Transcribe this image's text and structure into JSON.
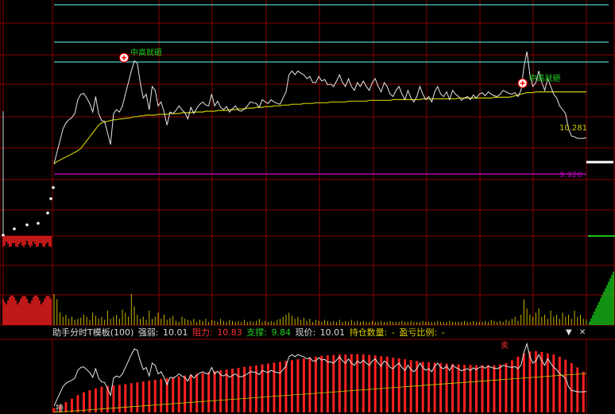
{
  "colors": {
    "background": "#000000",
    "grid": "#8b0000",
    "price_line": "#e6e6e6",
    "avg_line": "#c8c800",
    "cyan": "#4fc9c9",
    "purple": "#b400b4",
    "up": "#ff2020",
    "down": "#19c219",
    "vol_yellow": "#c8b400",
    "signal_green": "#1ed01e"
  },
  "indicator_bar": {
    "name": "助手分时T模板(100)",
    "strength_label": "强弱:",
    "strength_value": "10.01",
    "resistance_label": "阻力:",
    "resistance_value": "10.83",
    "support_label": "支撑:",
    "support_value": "9.84",
    "price_label": "现价:",
    "price_value": "10.01",
    "position_label": "持仓数量:",
    "position_value": "-",
    "pnl_label": "盈亏比例:",
    "pnl_value": "-",
    "menu_icon": "dropdown-arrow-icon",
    "close_icon": "close-icon"
  },
  "chart_data": {
    "type": "line",
    "price_axis_labels": [
      "10.281",
      "9.920"
    ],
    "signals": [
      {
        "text": "中高就砸",
        "at_index": 27
      },
      {
        "text": "中高就砸",
        "at_index": 161
      }
    ],
    "lower_signal": {
      "text": "卖"
    },
    "lower_label": {
      "text": "持"
    },
    "price": [
      10.05,
      10.2,
      10.35,
      10.5,
      10.58,
      10.62,
      10.65,
      10.7,
      10.88,
      10.95,
      10.96,
      10.9,
      10.83,
      10.72,
      10.92,
      10.7,
      10.61,
      10.6,
      10.45,
      10.3,
      10.7,
      10.75,
      10.72,
      10.8,
      10.95,
      11.1,
      11.25,
      11.38,
      11.35,
      11.1,
      10.9,
      10.95,
      10.75,
      11.05,
      11.0,
      10.8,
      10.85,
      10.72,
      10.55,
      10.72,
      10.7,
      10.74,
      10.8,
      10.75,
      10.71,
      10.63,
      10.78,
      10.7,
      10.77,
      10.82,
      10.85,
      10.81,
      10.8,
      10.95,
      10.8,
      10.86,
      10.78,
      10.75,
      10.79,
      10.72,
      10.76,
      10.8,
      10.74,
      10.73,
      10.76,
      10.8,
      10.85,
      10.84,
      10.83,
      10.78,
      10.88,
      10.85,
      10.83,
      10.88,
      10.85,
      10.83,
      10.82,
      10.9,
      10.98,
      11.2,
      11.25,
      11.2,
      11.25,
      11.22,
      11.2,
      11.15,
      11.18,
      11.1,
      11.1,
      11.18,
      11.12,
      11.14,
      11.07,
      11.08,
      11.05,
      11.12,
      11.2,
      11.1,
      11.05,
      11.15,
      11.05,
      11.0,
      11.1,
      11.05,
      11.12,
      11.05,
      11.0,
      11.1,
      11.15,
      11.05,
      10.98,
      11.1,
      11.05,
      10.95,
      10.92,
      11.0,
      11.05,
      10.95,
      10.88,
      11.0,
      10.9,
      10.85,
      10.92,
      11.05,
      10.95,
      10.88,
      10.92,
      10.85,
      10.98,
      11.05,
      10.95,
      10.92,
      10.98,
      10.88,
      11.0,
      10.95,
      10.92,
      10.87,
      10.9,
      10.92,
      10.88,
      10.94,
      10.9,
      10.95,
      10.97,
      10.93,
      10.98,
      10.95,
      10.93,
      10.92,
      10.95,
      11.0,
      10.98,
      10.96,
      10.95,
      10.97,
      10.92,
      11.0,
      11.3,
      11.5,
      11.2,
      11.05,
      11.1,
      11.25,
      11.1,
      11.0,
      11.15,
      11.05,
      10.95,
      10.9,
      10.8,
      10.75,
      10.7,
      10.5,
      10.41,
      10.4,
      10.38,
      10.38,
      10.38,
      10.39
    ],
    "avg": [
      10.05,
      10.08,
      10.1,
      10.12,
      10.14,
      10.16,
      10.18,
      10.2,
      10.22,
      10.25,
      10.3,
      10.35,
      10.4,
      10.45,
      10.5,
      10.55,
      10.58,
      10.59,
      10.6,
      10.61,
      10.62,
      10.62,
      10.63,
      10.63,
      10.64,
      10.64,
      10.65,
      10.66,
      10.66,
      10.67,
      10.67,
      10.68,
      10.68,
      10.68,
      10.68,
      10.69,
      10.69,
      10.69,
      10.69,
      10.7,
      10.7,
      10.7,
      10.7,
      10.71,
      10.71,
      10.71,
      10.71,
      10.72,
      10.72,
      10.72,
      10.72,
      10.73,
      10.73,
      10.73,
      10.73,
      10.74,
      10.74,
      10.74,
      10.74,
      10.75,
      10.75,
      10.75,
      10.76,
      10.76,
      10.76,
      10.77,
      10.77,
      10.77,
      10.78,
      10.78,
      10.78,
      10.79,
      10.79,
      10.79,
      10.8,
      10.8,
      10.8,
      10.81,
      10.81,
      10.81,
      10.82,
      10.82,
      10.82,
      10.82,
      10.83,
      10.83,
      10.83,
      10.83,
      10.84,
      10.84,
      10.84,
      10.84,
      10.84,
      10.85,
      10.85,
      10.85,
      10.85,
      10.85,
      10.85,
      10.86,
      10.86,
      10.86,
      10.86,
      10.86,
      10.86,
      10.86,
      10.87,
      10.87,
      10.87,
      10.87,
      10.87,
      10.87,
      10.87,
      10.87,
      10.88,
      10.88,
      10.88,
      10.88,
      10.88,
      10.88,
      10.88,
      10.88,
      10.88,
      10.88,
      10.89,
      10.89,
      10.89,
      10.89,
      10.89,
      10.89,
      10.89,
      10.89,
      10.89,
      10.89,
      10.89,
      10.89,
      10.9,
      10.9,
      10.9,
      10.9,
      10.9,
      10.9,
      10.9,
      10.9,
      10.9,
      10.9,
      10.9,
      10.9,
      10.91,
      10.91,
      10.91,
      10.91,
      10.91,
      10.91,
      10.92,
      10.93,
      10.94,
      10.95,
      10.96,
      10.97,
      10.97,
      10.97,
      10.98,
      10.98,
      10.98,
      10.98,
      10.98,
      10.98,
      10.98,
      10.98,
      10.98,
      10.98,
      10.98,
      10.98,
      10.98,
      10.98,
      10.98,
      10.98,
      10.98,
      10.98
    ],
    "volume": [
      30,
      25,
      12,
      8,
      10,
      6,
      8,
      5,
      6,
      7,
      10,
      8,
      5,
      12,
      9,
      6,
      8,
      5,
      14,
      6,
      8,
      10,
      6,
      15,
      12,
      8,
      30,
      18,
      10,
      6,
      8,
      5,
      14,
      6,
      8,
      12,
      6,
      10,
      5,
      7,
      9,
      4,
      3,
      8,
      6,
      5,
      4,
      6,
      3,
      5,
      4,
      6,
      3,
      5,
      4,
      3,
      6,
      4,
      3,
      5,
      4,
      3,
      4,
      3,
      5,
      3,
      4,
      3,
      4,
      6,
      3,
      4,
      3,
      4,
      3,
      5,
      6,
      8,
      10,
      12,
      9,
      6,
      8,
      5,
      7,
      4,
      6,
      3,
      5,
      4,
      3,
      5,
      4,
      3,
      4,
      3,
      5,
      3,
      4,
      3,
      5,
      3,
      4,
      3,
      4,
      3,
      3,
      4,
      3,
      3,
      4,
      3,
      3,
      4,
      3,
      3,
      3,
      4,
      3,
      3,
      4,
      3,
      3,
      3,
      4,
      3,
      3,
      3,
      3,
      4,
      3,
      3,
      3,
      4,
      3,
      3,
      3,
      3,
      4,
      3,
      3,
      4,
      3,
      3,
      3,
      4,
      3,
      5,
      4,
      3,
      4,
      3,
      5,
      4,
      6,
      8,
      4,
      10,
      25,
      16,
      10,
      8,
      12,
      16,
      8,
      10,
      6,
      14,
      8,
      10,
      6,
      12,
      8,
      10,
      6,
      14,
      8,
      10,
      6,
      5
    ],
    "lower_curve": [
      10.0,
      10.02,
      10.06,
      10.1,
      10.14,
      10.18,
      10.22,
      10.26,
      10.3,
      10.34,
      10.37,
      10.4,
      10.42,
      10.44,
      10.46,
      10.48,
      10.5,
      10.51,
      10.52,
      10.52,
      10.53,
      10.54,
      10.54,
      10.55,
      10.56,
      10.57,
      10.58,
      10.59,
      10.6,
      10.61,
      10.62,
      10.63,
      10.64,
      10.65,
      10.66,
      10.67,
      10.68,
      10.69,
      10.7,
      10.71,
      10.72,
      10.73,
      10.74,
      10.75,
      10.76,
      10.77,
      10.78,
      10.79,
      10.8,
      10.81,
      10.82,
      10.83,
      10.84,
      10.85,
      10.86,
      10.87,
      10.88,
      10.89,
      10.9,
      10.91,
      10.92,
      10.93,
      10.94,
      10.95,
      10.96,
      10.97,
      10.98,
      10.99,
      11.0,
      11.01,
      11.02,
      11.03,
      11.04,
      11.05,
      11.06,
      11.07,
      11.08,
      11.09,
      11.1,
      11.11,
      11.12,
      11.13,
      11.14,
      11.15,
      11.16,
      11.17,
      11.18,
      11.19,
      11.2,
      11.21,
      11.22,
      11.22,
      11.23,
      11.23,
      11.24,
      11.24,
      11.25,
      11.25,
      11.25,
      11.26,
      11.26,
      11.26,
      11.26,
      11.26,
      11.25,
      11.25,
      11.24,
      11.24,
      11.23,
      11.22,
      11.21,
      11.2,
      11.2,
      11.19,
      11.18,
      11.17,
      11.16,
      11.15,
      11.14,
      11.13,
      11.12,
      11.11,
      11.1,
      11.09,
      11.08,
      11.08,
      11.07,
      11.06,
      11.06,
      11.05,
      11.05,
      11.04,
      11.04,
      11.03,
      11.03,
      11.02,
      11.02,
      11.02,
      11.01,
      11.01,
      11.01,
      11.01,
      11.0,
      11.0,
      11.0,
      11.0,
      11.0,
      11.0,
      11.0,
      11.01,
      11.02,
      11.03,
      11.05,
      11.08,
      11.12,
      11.16,
      11.2,
      11.24,
      11.28,
      11.3,
      11.32,
      11.33,
      11.33,
      11.32,
      11.31,
      11.3,
      11.28,
      11.27,
      11.25,
      11.23,
      11.2,
      11.17,
      11.13,
      11.09,
      11.05,
      11.0,
      10.95,
      10.9,
      10.85,
      10.8
    ]
  }
}
